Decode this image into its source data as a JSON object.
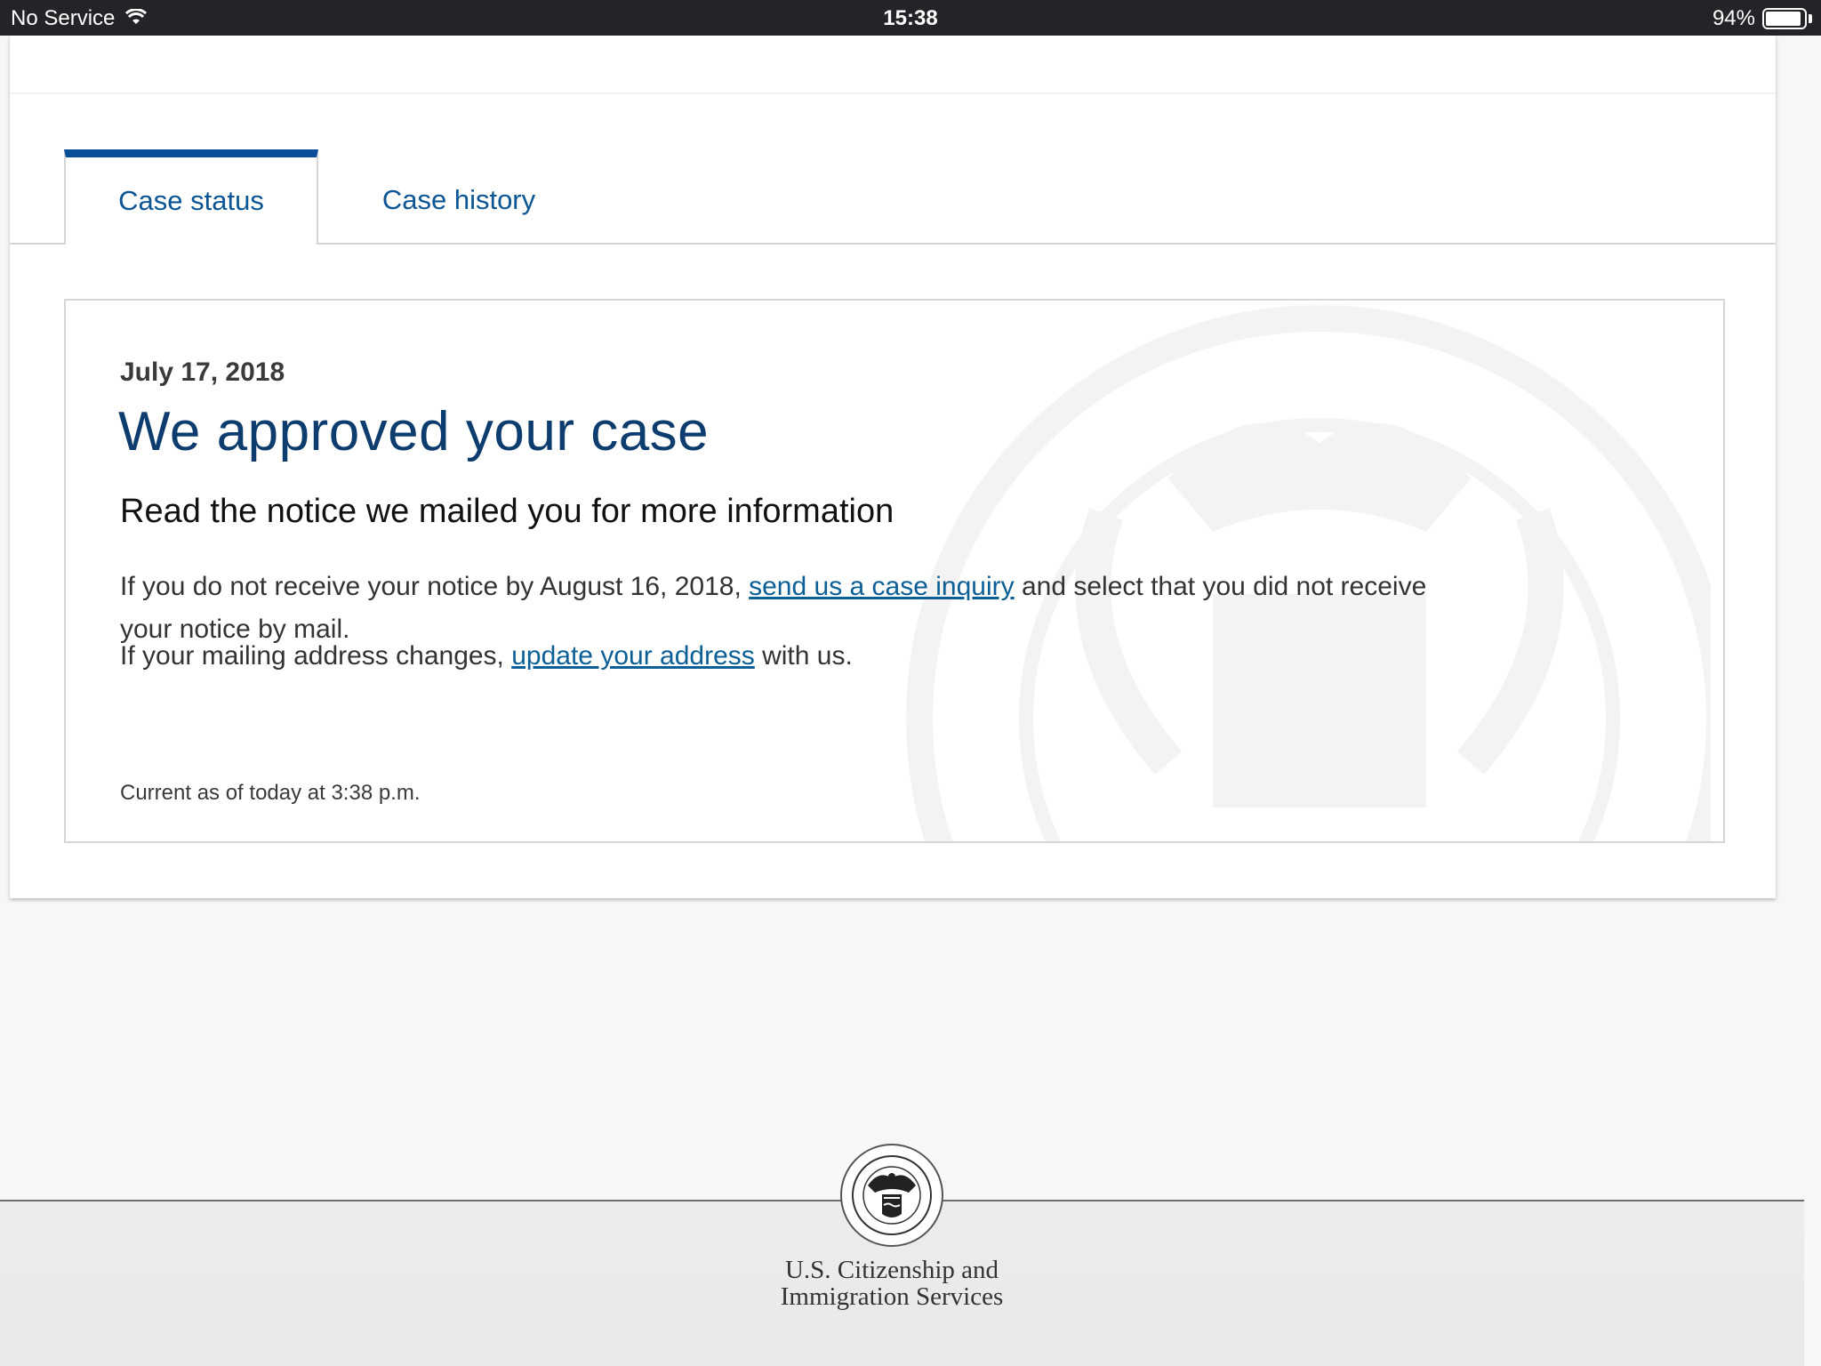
{
  "status_bar": {
    "carrier": "No Service",
    "time": "15:38",
    "battery_percent": "94%",
    "battery_level": 0.94,
    "wifi_icon": "wifi-icon",
    "battery_icon": "battery-icon"
  },
  "tabs": [
    {
      "label": "Case status",
      "active": true
    },
    {
      "label": "Case history",
      "active": false
    }
  ],
  "case": {
    "date": "July 17, 2018",
    "title": "We approved your case",
    "subtitle": "Read the notice we mailed you for more information",
    "paragraph1": {
      "before": "If you do not receive your notice by August 16, 2018, ",
      "link": "send us a case inquiry",
      "after": " and select that you did not receive your notice by mail."
    },
    "paragraph2": {
      "before": "If your mailing address changes, ",
      "link": "update your address",
      "after": " with us."
    },
    "current_as_of": "Current as of today at 3:38 p.m."
  },
  "footer": {
    "agency_line1": "U.S. Citizenship and",
    "agency_line2": "Immigration Services",
    "seal_icon": "dhs-seal-icon"
  },
  "colors": {
    "tab_accent": "#0a4d99",
    "title": "#0d3d6e",
    "link": "#0b5f96",
    "status_bar": "#232427"
  }
}
